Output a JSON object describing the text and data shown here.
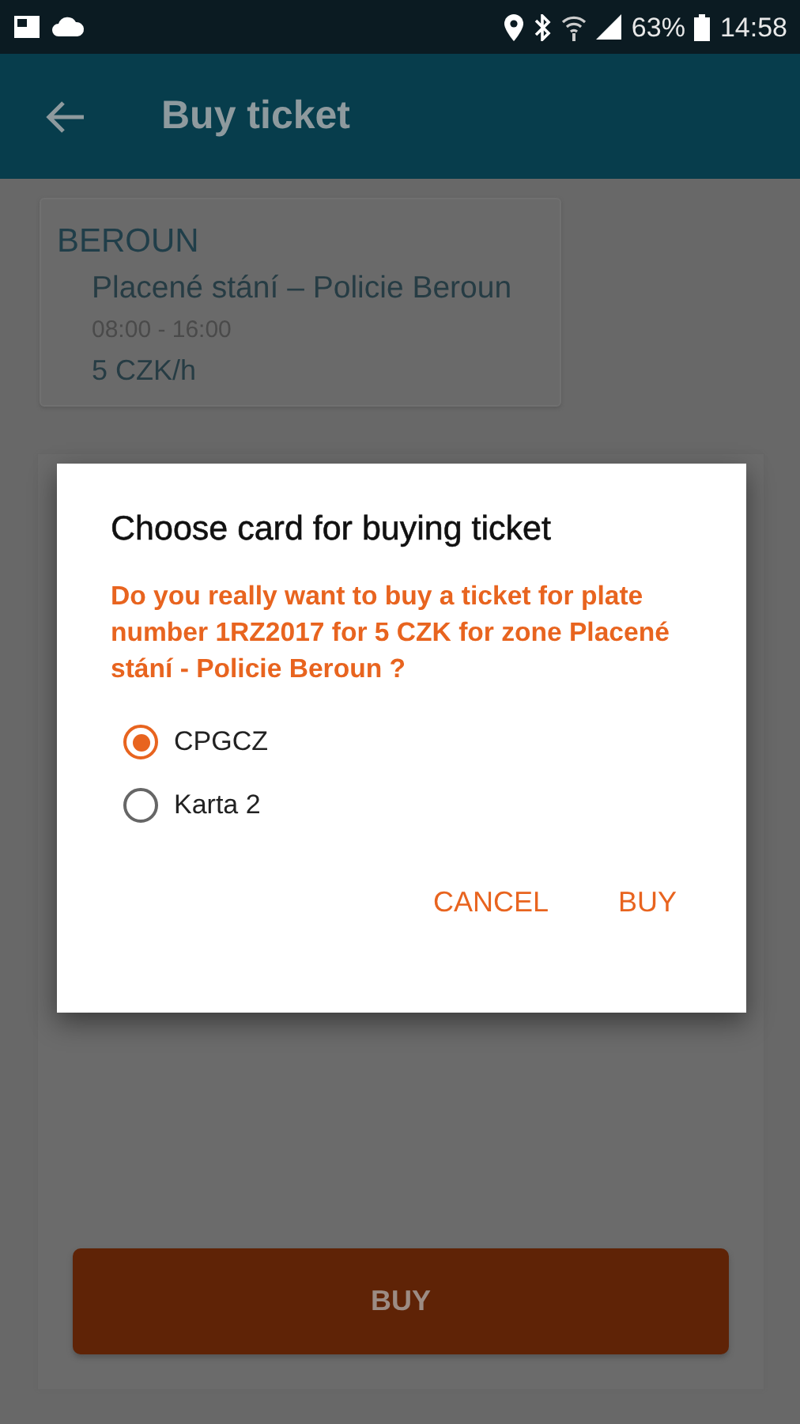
{
  "status_bar": {
    "battery": "63%",
    "time": "14:58"
  },
  "app_bar": {
    "title": "Buy ticket"
  },
  "zone_card": {
    "city": "BEROUN",
    "zone": "Placené stání – Policie Beroun",
    "hours": "08:00 - 16:00",
    "price": "5 CZK/h"
  },
  "buy_button": {
    "label": "BUY"
  },
  "dialog": {
    "title": "Choose card for buying ticket",
    "message": "Do you really want to buy a ticket for plate number 1RZ2017 for 5 CZK for zone Placené stání - Policie Beroun ?",
    "options": [
      {
        "label": "CPGCZ",
        "selected": true
      },
      {
        "label": "Karta 2",
        "selected": false
      }
    ],
    "buttons": [
      {
        "label": "CANCEL"
      },
      {
        "label": "BUY"
      }
    ]
  }
}
